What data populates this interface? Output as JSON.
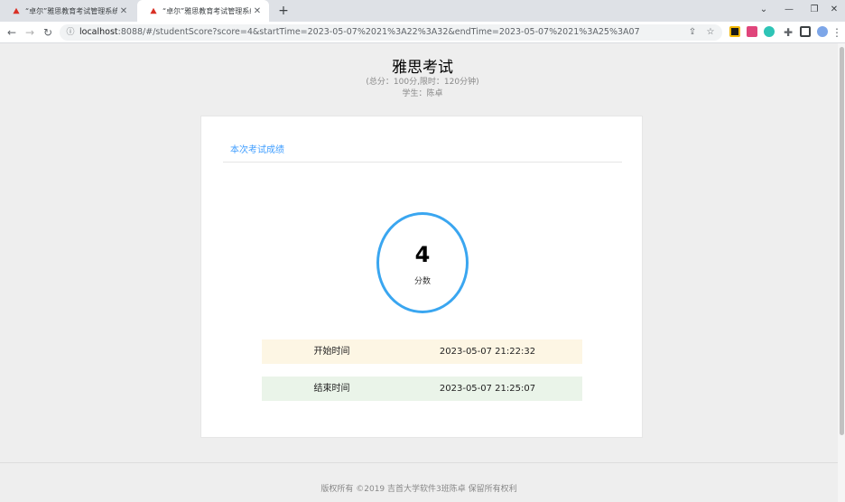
{
  "browser": {
    "tabs": [
      {
        "title": "“卓尔”雅思教育考试管理系统",
        "active": false
      },
      {
        "title": "“卓尔”雅思教育考试管理系统",
        "active": true
      }
    ],
    "new_tab": "+",
    "url_host": "localhost",
    "url_rest": ":8088/#/studentScore?score=4&startTime=2023-05-07%2021%3A22%3A32&endTime=2023-05-07%2021%3A25%3A07",
    "favicon_color": "#d93025"
  },
  "header": {
    "title": "雅思考试",
    "meta": "(总分：100分,限时：120分钟)",
    "student": "学生：陈卓"
  },
  "card": {
    "heading": "本次考试成绩",
    "heading_color": "#409eff",
    "score": "4",
    "score_label": "分数",
    "ring_color": "#3aa6f0",
    "start_label": "开始时间",
    "start_value": "2023-05-07 21:22:32",
    "end_label": "结束时间",
    "end_value": "2023-05-07 21:25:07"
  },
  "footer": {
    "text": "版权所有 ©2019 吉首大学软件3班陈卓 保留所有权利"
  }
}
